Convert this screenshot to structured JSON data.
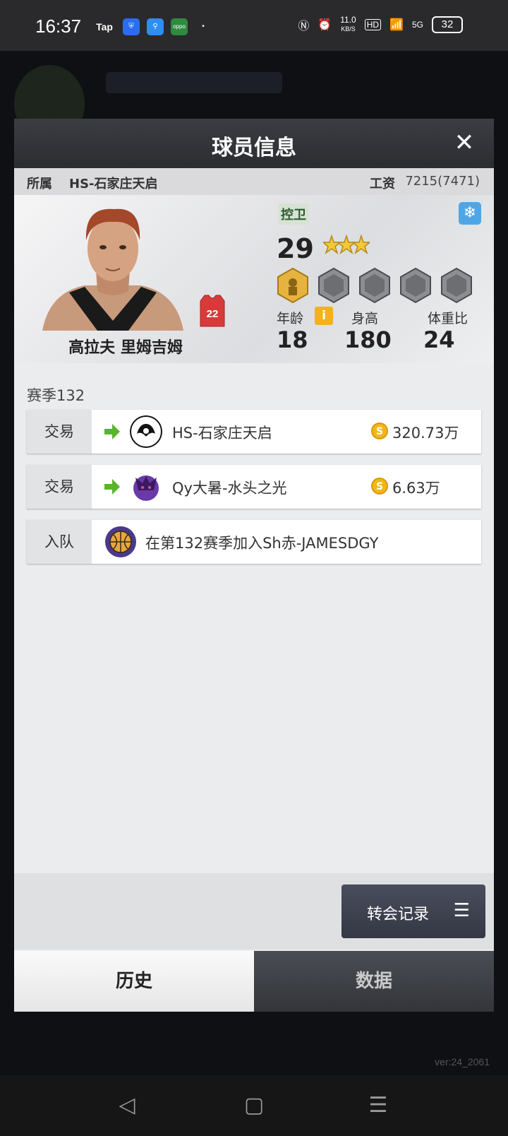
{
  "status_bar": {
    "time": "16:37",
    "app_icons": [
      "Tap",
      "shield",
      "search",
      "oppo"
    ],
    "net_speed": "11.0",
    "net_unit": "KB/S",
    "hd": "HD",
    "signal": "5G",
    "battery": "32"
  },
  "modal": {
    "title": "球员信息",
    "affiliation_label": "所属",
    "affiliation_value": "HS-石家庄天启",
    "salary_label": "工资",
    "salary_value": "7215(7471)"
  },
  "player": {
    "name": "高拉夫 里姆吉姆",
    "jersey_number": "22",
    "position": "控卫",
    "rating": "29",
    "stars": 3,
    "age_label": "年龄",
    "age": "18",
    "height_label": "身高",
    "height": "180",
    "weight_ratio_label": "体重比",
    "weight_ratio": "24",
    "info_icon_text": "i"
  },
  "history": {
    "season": "赛季132",
    "records": [
      {
        "type": "交易",
        "team": "HS-石家庄天启",
        "fee": "320.73万"
      },
      {
        "type": "交易",
        "team": "Qy大暑-水头之光",
        "fee": "6.63万"
      },
      {
        "type": "入队",
        "text": "在第132赛季加入Sh赤-JAMESDGY"
      }
    ]
  },
  "buttons": {
    "transfer_record": "转会记录",
    "list_icon": "☰"
  },
  "tabs": {
    "history": "历史",
    "data": "数据"
  },
  "version": "ver:24_2061",
  "colors": {
    "header_dark": "#2b2d31",
    "accent_green": "#5ab52c",
    "coin_gold": "#f2b51c",
    "snow_blue": "#4fa6e6"
  }
}
